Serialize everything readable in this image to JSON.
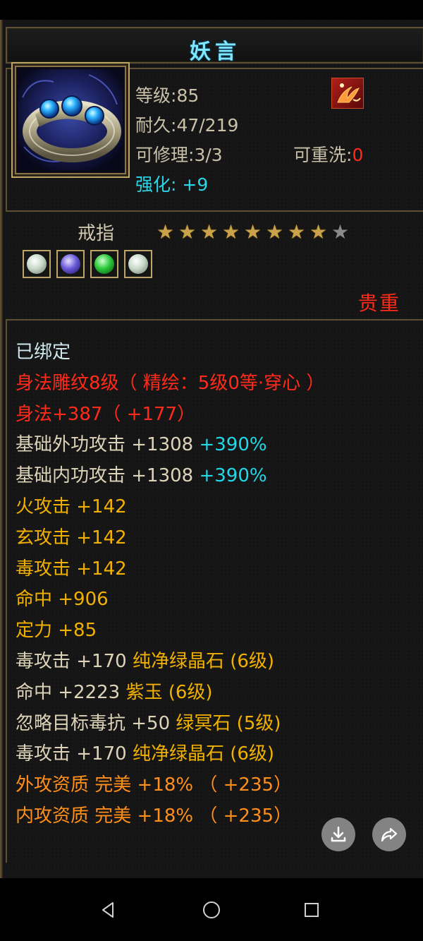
{
  "item": {
    "name": "妖言",
    "level_label": "等级:",
    "level_value": "85",
    "durability_label": "耐久:",
    "durability_value": "47/219",
    "repair_label": "可修理:",
    "repair_value": "3/3",
    "rewash_label": "可重洗:",
    "rewash_value": "0",
    "enhance_label": "强化:",
    "enhance_value": "+9",
    "type": "戒指",
    "stars_total": 9,
    "stars_filled": 8,
    "rarity": "贵重",
    "gem_sockets": [
      "white-gem-icon",
      "purple-gem-icon",
      "green-gem-icon",
      "white-gem-icon"
    ]
  },
  "attributes": [
    {
      "parts": [
        {
          "text": "已绑定",
          "color": "white"
        }
      ]
    },
    {
      "parts": [
        {
          "text": "身法雕纹8级（ 精绘：5级0等·穿心 ）",
          "color": "red"
        }
      ]
    },
    {
      "parts": [
        {
          "text": "身法+387（ +177）",
          "color": "red"
        }
      ]
    },
    {
      "parts": [
        {
          "text": "基础外功攻击 +1308 ",
          "color": "tan"
        },
        {
          "text": "+390%",
          "color": "cyan"
        }
      ]
    },
    {
      "parts": [
        {
          "text": "基础内功攻击 +1308 ",
          "color": "tan"
        },
        {
          "text": "+390%",
          "color": "cyan"
        }
      ]
    },
    {
      "parts": [
        {
          "text": "火攻击 +142",
          "color": "yellow"
        }
      ]
    },
    {
      "parts": [
        {
          "text": "玄攻击 +142",
          "color": "yellow"
        }
      ]
    },
    {
      "parts": [
        {
          "text": "毒攻击 +142",
          "color": "yellow"
        }
      ]
    },
    {
      "parts": [
        {
          "text": "命中 +906",
          "color": "yellow"
        }
      ]
    },
    {
      "parts": [
        {
          "text": "定力 +85",
          "color": "yellow"
        }
      ]
    },
    {
      "parts": [
        {
          "text": "毒攻击 +170 ",
          "color": "tan"
        },
        {
          "text": "纯净绿晶石 (6级)",
          "color": "yellow"
        }
      ]
    },
    {
      "parts": [
        {
          "text": "命中 +2223 ",
          "color": "tan"
        },
        {
          "text": "紫玉 (6级)",
          "color": "yellow"
        }
      ]
    },
    {
      "parts": [
        {
          "text": "忽略目标毒抗 +50 ",
          "color": "tan"
        },
        {
          "text": "绿冥石 (5级)",
          "color": "yellow"
        }
      ]
    },
    {
      "parts": [
        {
          "text": "毒攻击 +170 ",
          "color": "tan"
        },
        {
          "text": "纯净绿晶石 (6级)",
          "color": "yellow"
        }
      ]
    },
    {
      "parts": [
        {
          "text": "外攻资质  完美 +18% （ +235）",
          "color": "orange"
        }
      ]
    },
    {
      "parts": [
        {
          "text": "内攻资质  完美 +18% （ +235）",
          "color": "orange"
        }
      ]
    }
  ],
  "actions": {
    "download_icon": "download-icon",
    "share_icon": "share-icon"
  },
  "navbar": {
    "back_icon": "back-triangle-icon",
    "home_icon": "home-circle-icon",
    "recents_icon": "recents-square-icon"
  }
}
